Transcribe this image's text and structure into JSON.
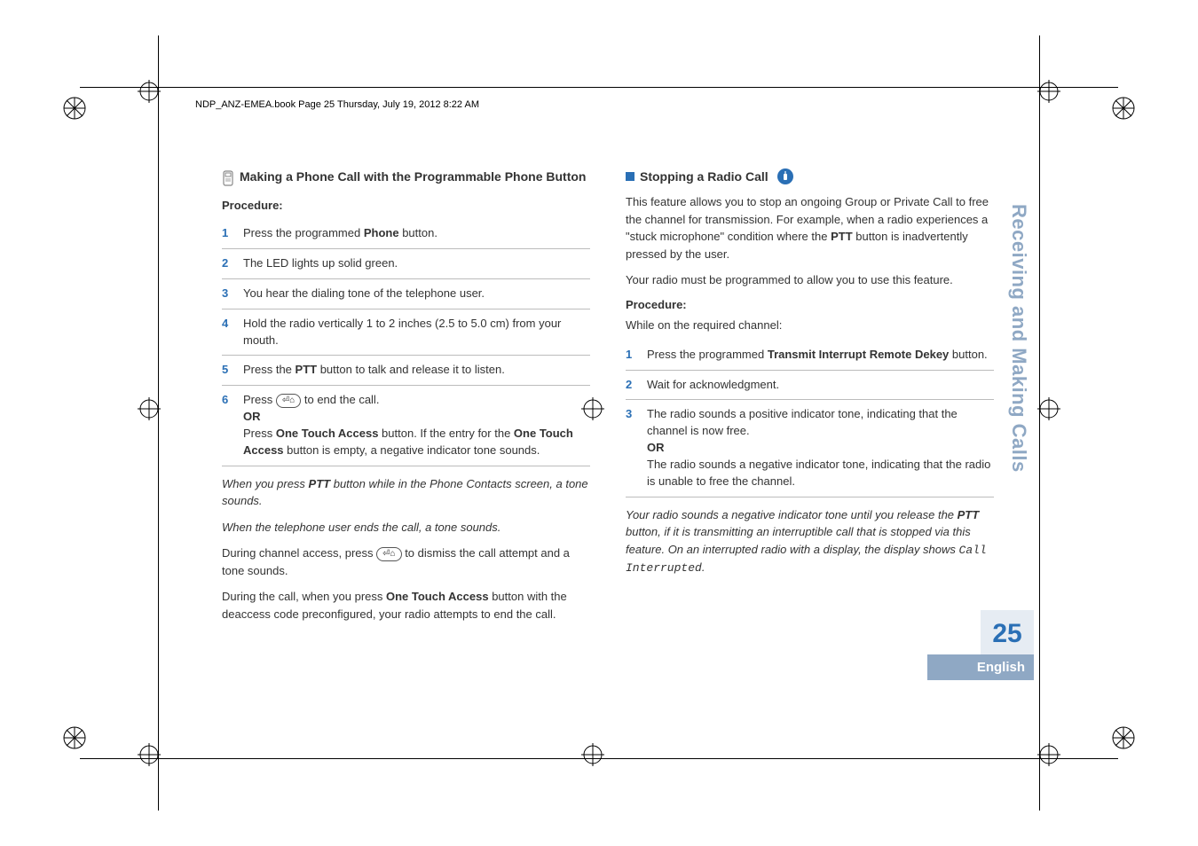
{
  "print_header": "NDP_ANZ-EMEA.book  Page 25  Thursday, July 19, 2012  8:22 AM",
  "sidebar_title": "Receiving and Making Calls",
  "page_number": "25",
  "language": "English",
  "left": {
    "heading": "Making a Phone Call with the Programmable Phone Button",
    "procedure_label": "Procedure:",
    "steps": [
      {
        "n": "1",
        "html": "Press the programmed <b>Phone</b> button."
      },
      {
        "n": "2",
        "html": "The LED lights up solid green."
      },
      {
        "n": "3",
        "html": "You hear the dialing tone of the telephone user."
      },
      {
        "n": "4",
        "html": "Hold the radio vertically 1 to 2 inches (2.5 to 5.0 cm) from your mouth."
      },
      {
        "n": "5",
        "html": "Press the <b>PTT</b> button to talk and release it to listen."
      },
      {
        "n": "6",
        "html": "Press <span class='btn-icon'>⏎⌂</span> to end the call.<br><b>OR</b><br>Press <b>One Touch Access</b> button. If the entry for the <b>One Touch Access</b> button is empty, a negative indicator tone sounds."
      }
    ],
    "note1": "When you press <b>PTT</b> button while in the Phone Contacts screen, a tone sounds.",
    "note2": "When the telephone user ends the call, a tone sounds.",
    "para1": "During channel access, press <span class='btn-icon'>⏎⌂</span> to dismiss the call attempt and a tone sounds.",
    "para2": "During the call, when you press <b>One Touch Access</b> button with the deaccess code preconfigured, your radio attempts to end the call."
  },
  "right": {
    "heading": "Stopping a Radio Call",
    "intro": "This feature allows you to stop an ongoing Group or Private Call to free the channel for transmission. For example, when a radio experiences a \"stuck microphone\" condition where the <b>PTT</b> button is inadvertently pressed by the user.",
    "intro2": "Your radio must be programmed to allow you to use this feature.",
    "procedure_label": "Procedure:",
    "procedure_sub": "While on the required channel:",
    "steps": [
      {
        "n": "1",
        "html": "Press the programmed <b>Transmit Interrupt Remote Dekey</b> button."
      },
      {
        "n": "2",
        "html": "Wait for acknowledgment."
      },
      {
        "n": "3",
        "html": "The radio sounds a positive indicator tone, indicating that the channel is now free.<br><b>OR</b><br>The radio sounds a negative indicator tone, indicating that the radio is unable to free the channel."
      }
    ],
    "closing": "Your radio sounds a negative indicator tone until you release the <b>PTT</b> button, if it is transmitting an interruptible call that is stopped via this feature. On an interrupted radio with a display, the display shows <span class='mono'>Call Interrupted</span>."
  }
}
